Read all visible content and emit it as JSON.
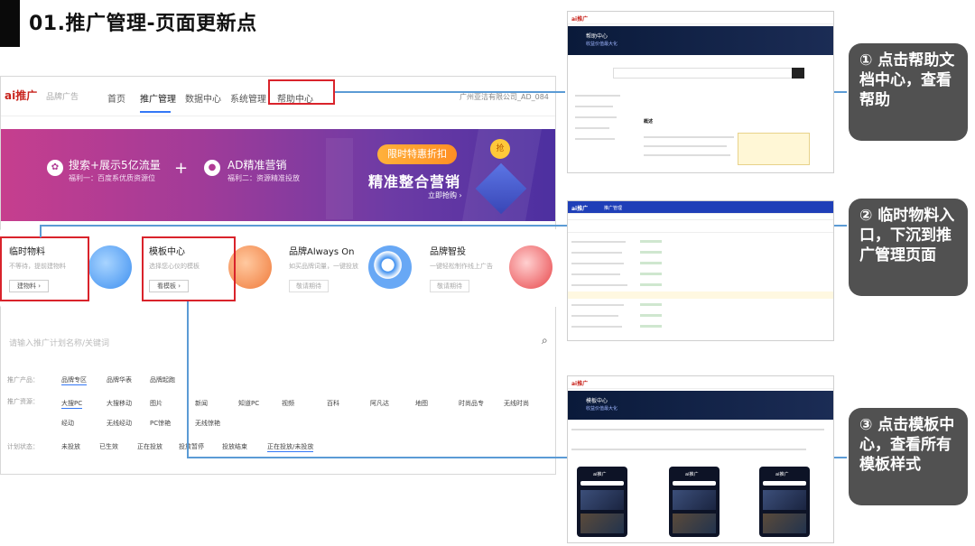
{
  "slide": {
    "title": "01.推广管理-页面更新点"
  },
  "main": {
    "nav": {
      "logo": "ai推广",
      "logo_sub": "品牌广告",
      "items": [
        "首页",
        "推广管理",
        "数据中心",
        "系统管理",
        "帮助中心"
      ],
      "active_index": 1,
      "company": "广州亚洁有限公司_AD_084"
    },
    "banner": {
      "item1_title": "搜索+展示5亿流量",
      "item1_sub": "福利一：百度系优质资源位",
      "item2_title": "AD精准营销",
      "item2_sub": "福利二：资源精准投放",
      "plus": "+",
      "promo_pill": "限时特惠折扣",
      "slogan": "精准整合营销",
      "link": "立即抢购 ›",
      "coin": "抢"
    },
    "cards": [
      {
        "title": "临时物料",
        "desc": "不等待，提前建物料",
        "button": "建物料 ›"
      },
      {
        "title": "模板中心",
        "desc": "选择您心仪的模板",
        "button": "看模板 ›"
      },
      {
        "title": "品牌Always On",
        "desc": "如买品牌词量，一键投放",
        "button": "敬请期待"
      },
      {
        "title": "品牌智投",
        "desc": "一键轻松制作线上广告",
        "button": "敬请期待"
      }
    ],
    "search": {
      "placeholder": "请输入推广计划名称/关键词"
    },
    "filters": [
      {
        "label": "推广产品：",
        "tags": [
          "品牌专区",
          "品牌华表",
          "品牌起跑"
        ],
        "selected": 0
      },
      {
        "label": "推广资源：",
        "tags": [
          "大搜PC",
          "大搜移动",
          "图片",
          "新闻",
          "知道PC",
          "视频",
          "百科",
          "阿凡达",
          "地图",
          "时尚品专",
          "无线时尚"
        ],
        "selected": 0
      },
      {
        "label": "",
        "tags": [
          "经动",
          "无线经动",
          "PC惊艳",
          "无线惊艳"
        ],
        "selected": -1
      },
      {
        "label": "计划状态：",
        "tags": [
          "未投放",
          "已生效",
          "正在投放",
          "投放暂停",
          "投放结束",
          "正在投放/未投放"
        ],
        "selected": 5
      }
    ]
  },
  "thumbnails": {
    "help": {
      "banner_title": "帮助中心",
      "banner_sub": "收益价值最大化",
      "section": "概述"
    },
    "list": {
      "tab": "推广管理"
    },
    "templates": {
      "banner_title": "模板中心",
      "banner_sub": "收益价值最大化"
    }
  },
  "callouts": [
    {
      "text": "① 点击帮助文档中心，查看帮助"
    },
    {
      "text": "② 临时物料入口，下沉到推广管理页面"
    },
    {
      "text": "③ 点击模板中心，查看所有模板样式"
    }
  ],
  "colors": {
    "highlight": "#d9232b",
    "connector": "#5b9bd5",
    "callout_bg": "#515151",
    "accent_blue": "#3478f6"
  }
}
